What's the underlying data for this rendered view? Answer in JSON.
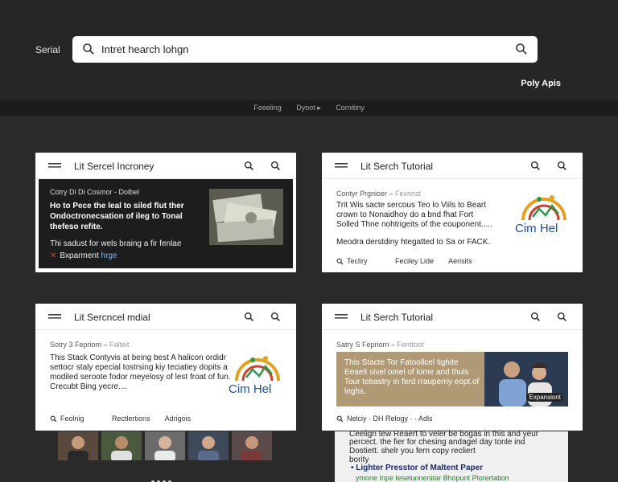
{
  "header": {
    "label": "Serial",
    "search_value": "Intret hearch lohgn",
    "account": "Poly Apis"
  },
  "nav": [
    "Feeeling",
    "Dyoot ▸",
    "Cornitiny"
  ],
  "cards": [
    {
      "title": "Lit Sercel Incroney",
      "meta": "Cotry Di Di Cosmor - Dolbel",
      "headline": "Ho to Pece the leal to siled flut ther Ondoctronecsation of ileg to Tonal thefeso refite.",
      "desc": "Thi sadust for wels braing a fir fenlae",
      "tag_label": "Bxparment",
      "tag_link": "hrge"
    },
    {
      "title": "Lit Serch Tutorial",
      "meta": "Contyr Prgnioer",
      "meta_src": "Fexrinst",
      "body": "Trit Wis sacte sercous Teo lo Viils to Beart crown to Nonaidhoy do a bnd fhat Fort Solled Thne nohtrigeits of the eouponent.....",
      "body2": "Meodra derstdiny htegatted to Sa or FACK.",
      "logo_text": "Cim Hel",
      "actions": [
        "Tecliry",
        "Feciley Lide",
        "Aerisits"
      ]
    },
    {
      "title": "Lit Sercncel mdial",
      "meta": "Sotry 3 Fepriom",
      "meta_src": "Falteit",
      "body": "This Stack Contyvis at being best A halicon ordidr settocr staly epecial tostrsing kiy teciatiey dopits a modiled seroote fodor meyelosy of lest froat of fun. Crecubt Bing yecre....",
      "logo_text": "Cim Hel",
      "actions": [
        "Feolnig",
        "Rectlertions",
        "Adrigois"
      ]
    },
    {
      "title": "Lit Serch Tutorial",
      "meta": "Satry S Fepriorn",
      "meta_src": "Fenttoot",
      "banner_text": "This Stacte Tor Fatoollcel tighite Eeaeit sivel omel of lome and thuis Tour tebastry in ferd rrauperriy eopt.of leghs.",
      "banner_label": "Expansiont",
      "actions_line": "Nelciy · DH Relogy · · Adls"
    }
  ],
  "document": {
    "line1": "Ceelign tew Reaert to veler be bogas in this and yeur",
    "line2": "percect. the fier for chesing andagel day tonle ind",
    "line3": "Dostiett. shelr you fern copy recliert",
    "line4": "bority",
    "subheading": "• Lighter Presstor of Maltent Paper",
    "green_line": "ymone Inpe teselunnenitar Bhopunt Plorertation"
  },
  "colors": {
    "accent": "#8ab4f8",
    "background": "#2a2a2a",
    "card": "#ffffff"
  }
}
